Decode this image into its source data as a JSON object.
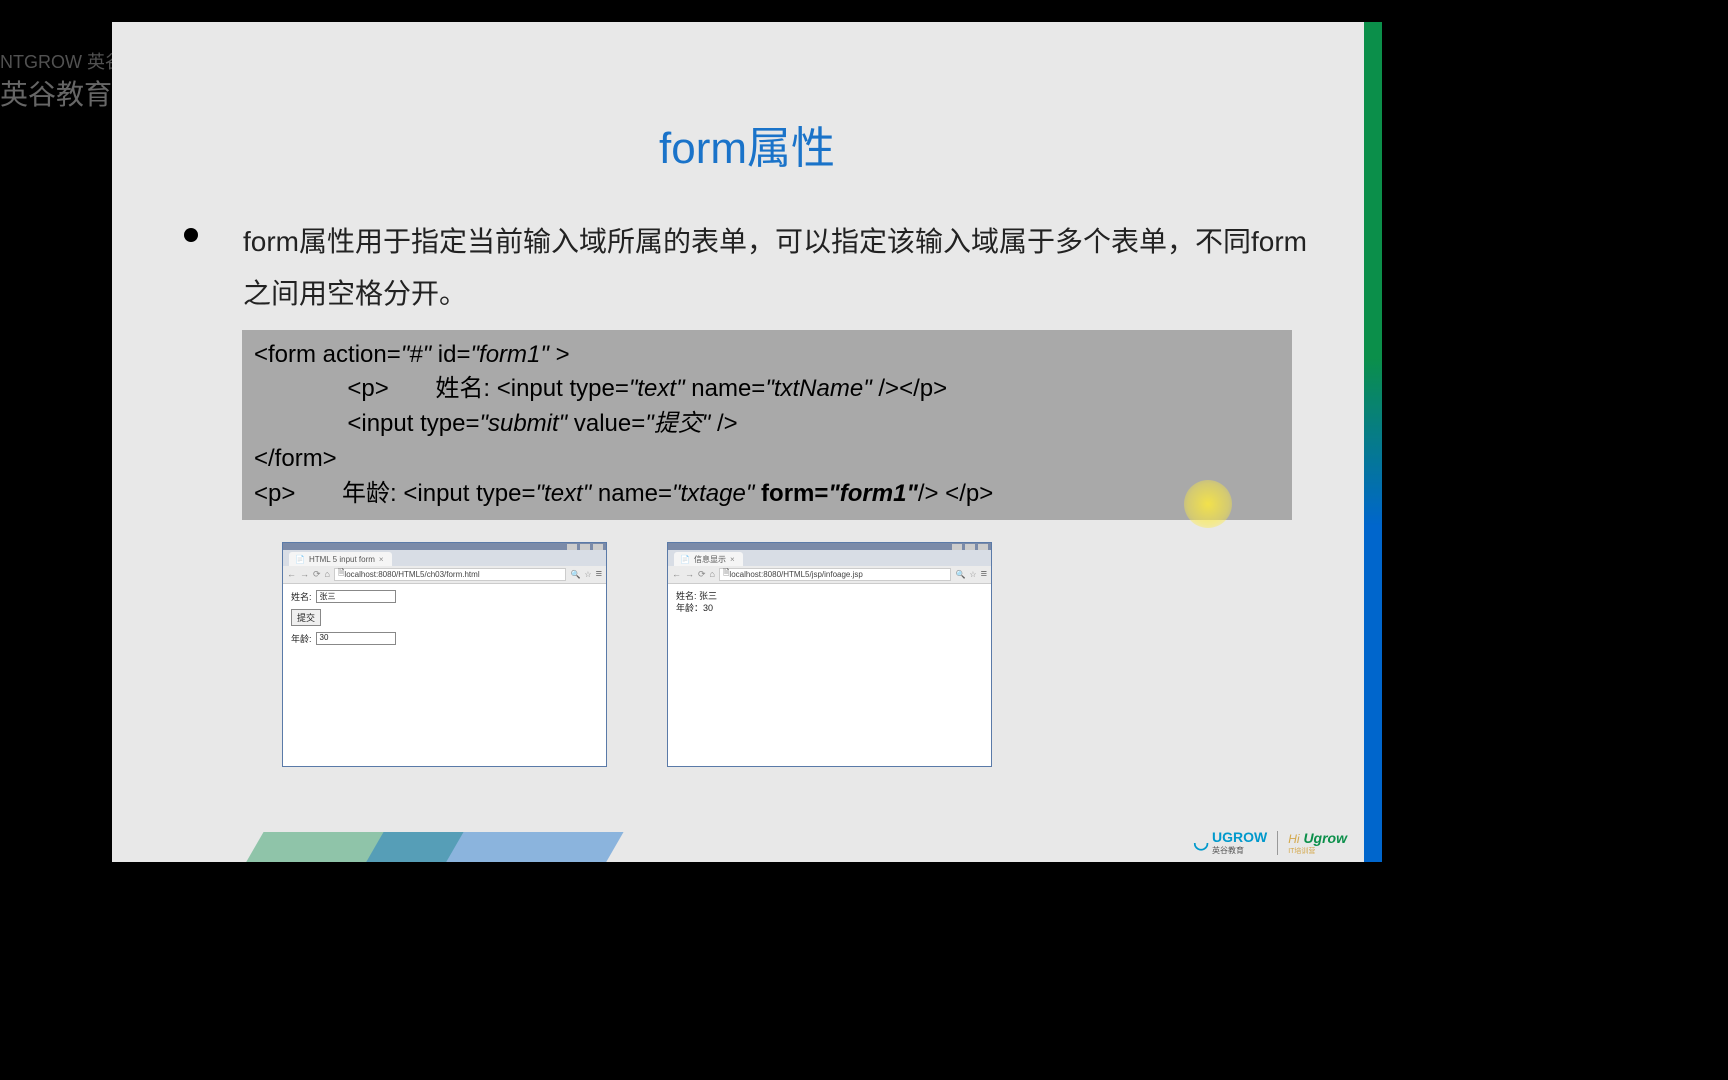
{
  "watermark": {
    "line1": "NTGROW 英谷",
    "line2": "英谷教育"
  },
  "slide": {
    "title": "form属性",
    "bullet_text": "form属性用于指定当前输入域所属的表单，可以指定该输入域属于多个表单，不同form之间用空格分开。",
    "code": {
      "line1_a": "<form action=",
      "line1_b": "\"#\"",
      "line1_c": " id=",
      "line1_d": "\"form1\"",
      "line1_e": " >",
      "line2_a": "              <p>       姓名: <input type=",
      "line2_b": "\"text\"",
      "line2_c": " name=",
      "line2_d": "\"txtName\"",
      "line2_e": " /></p>",
      "line3_a": "              <input type=",
      "line3_b": "\"submit\"",
      "line3_c": " value=",
      "line3_d": "\"提交\"",
      "line3_e": " />",
      "line4": "</form>",
      "line5_a": "<p>       年龄: <input type=",
      "line5_b": "\"text\"",
      "line5_c": " name=",
      "line5_d": "\"txtage\"",
      "line5_e": " form=",
      "line5_f": "\"form1\"",
      "line5_g": "/> </p>"
    }
  },
  "browser1": {
    "tab_title": "HTML 5 input form",
    "url": "localhost:8080/HTML5/ch03/form.html",
    "name_label": "姓名:",
    "name_value": "张三",
    "submit_label": "提交",
    "age_label": "年龄:",
    "age_value": "30"
  },
  "browser2": {
    "tab_title": "信息显示",
    "url": "localhost:8080/HTML5/jsp/infoage.jsp",
    "result_name": "姓名: 张三",
    "result_age": "年龄：30"
  },
  "footer": {
    "ugrow": "UGROW",
    "ugrow_sub": "英谷教育",
    "hi": "Hi",
    "hi_ugrow": "Ugrow",
    "hi_sub": "IT培训营"
  }
}
